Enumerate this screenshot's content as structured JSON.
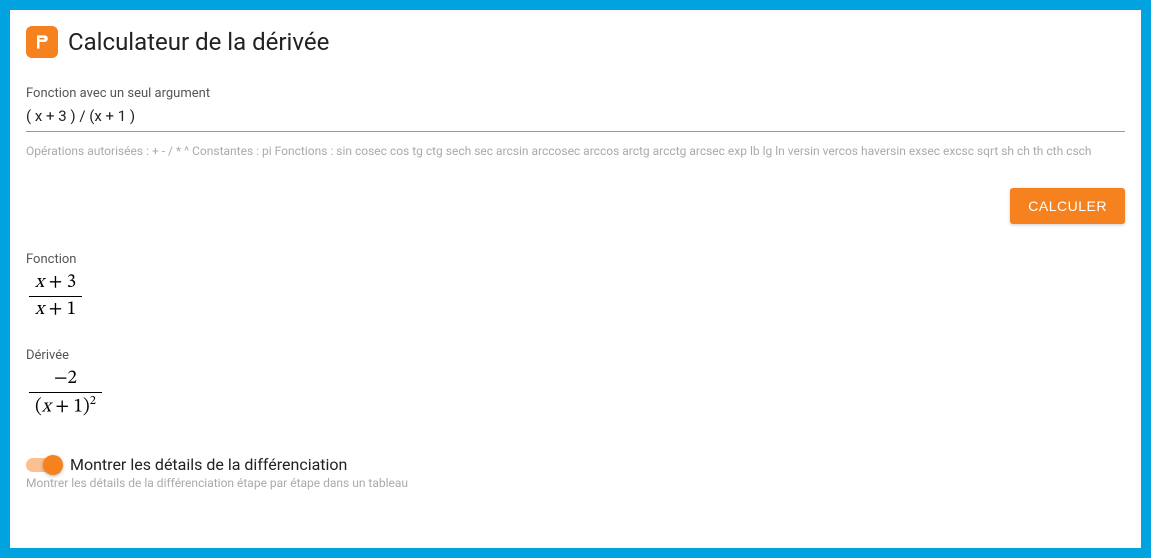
{
  "header": {
    "title": "Calculateur de la dérivée"
  },
  "input": {
    "label": "Fonction avec un seul argument",
    "value": "( x + 3 ) / (x + 1 )",
    "hint": "Opérations autorisées : + - / * ^ Constantes : pi Fonctions : sin cosec cos tg ctg sech sec arcsin arccosec arccos arctg arcctg arcsec exp lb lg ln versin vercos haversin exsec excsc sqrt sh ch th cth csch"
  },
  "buttons": {
    "calculate": "CALCULER"
  },
  "result": {
    "function_label": "Fonction",
    "derivative_label": "Dérivée",
    "function": {
      "numerator": "x + 3",
      "denominator": "x + 1"
    },
    "derivative": {
      "numerator": "−2",
      "denominator_base": "(x + 1)",
      "denominator_exp": "2"
    }
  },
  "toggle": {
    "label": "Montrer les détails de la différenciation",
    "hint": "Montrer les détails de la différenciation étape par étape dans un tableau",
    "on": true
  }
}
